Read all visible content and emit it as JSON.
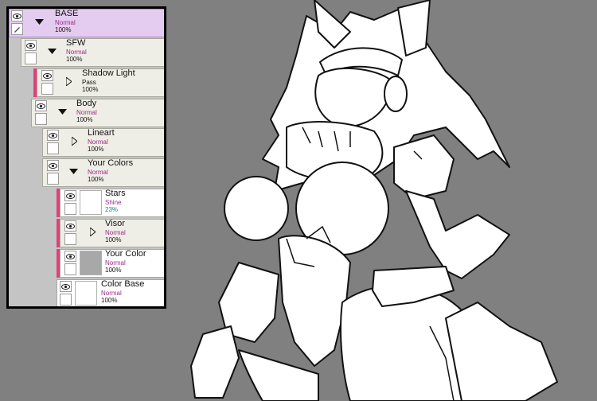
{
  "layers": [
    {
      "name": "BASE",
      "mode": "Normal",
      "opacity": "100%"
    },
    {
      "name": "SFW",
      "mode": "Normal",
      "opacity": "100%"
    },
    {
      "name": "Shadow Light",
      "mode": "Pass",
      "opacity": "100%"
    },
    {
      "name": "Body",
      "mode": "Normal",
      "opacity": "100%"
    },
    {
      "name": "Lineart",
      "mode": "Normal",
      "opacity": "100%"
    },
    {
      "name": "Your Colors",
      "mode": "Normal",
      "opacity": "100%"
    },
    {
      "name": "Stars",
      "mode": "Shine",
      "opacity": "23%"
    },
    {
      "name": "Visor",
      "mode": "Normal",
      "opacity": "100%"
    },
    {
      "name": "Your Color",
      "mode": "Normal",
      "opacity": "100%"
    },
    {
      "name": "Color Base",
      "mode": "Normal",
      "opacity": "100%"
    }
  ],
  "colors": {
    "canvas_background": "#808080",
    "selected_layer": "#e4ccf0",
    "clipping_marker": "#e0407a",
    "blend_mode_text": "#9a2a88"
  }
}
